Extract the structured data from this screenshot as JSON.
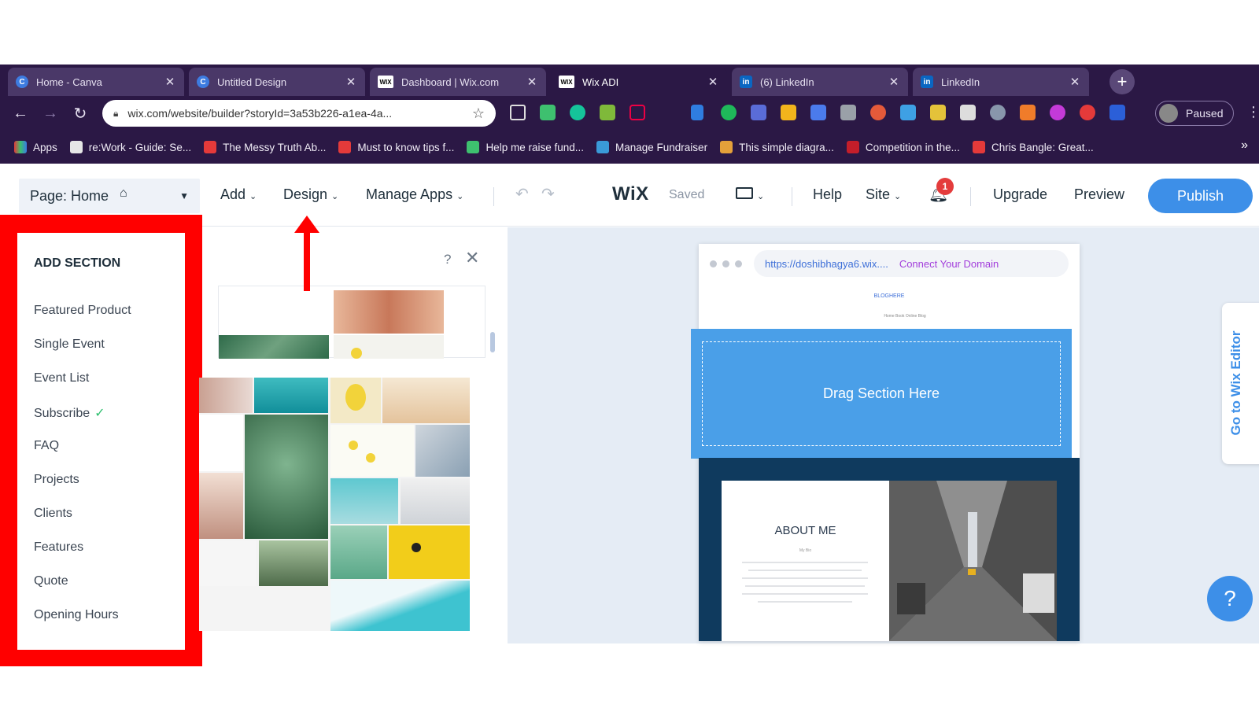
{
  "browser": {
    "tabs": [
      {
        "title": "Home - Canva",
        "close": "✕"
      },
      {
        "title": "Untitled Design",
        "close": "✕"
      },
      {
        "title": "Dashboard | Wix.com",
        "close": "✕"
      },
      {
        "title": "Wix ADI",
        "close": "✕"
      },
      {
        "title": "(6) LinkedIn",
        "close": "✕"
      },
      {
        "title": "LinkedIn",
        "close": "✕"
      }
    ],
    "new_tab": "+",
    "url": "wix.com/website/builder?storyId=3a53b226-a1ea-4a...",
    "profile_status": "Paused",
    "bookmarks": [
      "Apps",
      "re:Work - Guide: Se...",
      "The Messy Truth Ab...",
      "Must to know tips f...",
      "Help me raise fund...",
      "Manage Fundraiser",
      "This simple diagra...",
      "Competition in the...",
      "Chris Bangle: Great..."
    ],
    "bookmarks_more": "»"
  },
  "wix_bar": {
    "page_selector": "Page: Home",
    "menu": {
      "add": "Add",
      "design": "Design",
      "manage_apps": "Manage Apps",
      "help": "Help",
      "site": "Site",
      "upgrade": "Upgrade",
      "preview": "Preview"
    },
    "logo": "WiX",
    "status": "Saved",
    "notification_count": "1",
    "publish": "Publish"
  },
  "add_section": {
    "title": "ADD SECTION",
    "items": [
      "Featured Product",
      "Single Event",
      "Event List",
      "Subscribe",
      "FAQ",
      "Projects",
      "Clients",
      "Features",
      "Quote",
      "Opening Hours"
    ],
    "help": "?",
    "close": "✕"
  },
  "preview": {
    "site_url": "https://doshibhagya6.wix....",
    "connect_domain": "Connect Your Domain",
    "blog_name": "BLOGHERE",
    "nav_text": "Home   Book Online   Blog",
    "drag_text": "Drag Section Here",
    "about_title": "ABOUT ME",
    "about_sub": "My Bio"
  },
  "side_tab": "Go to Wix Editor",
  "help_button": "?",
  "colors": {
    "chrome_bg": "#2b1845",
    "accent": "#3d8fe8",
    "highlight_red": "#ff0000",
    "drag_section": "#4a9fe8"
  }
}
